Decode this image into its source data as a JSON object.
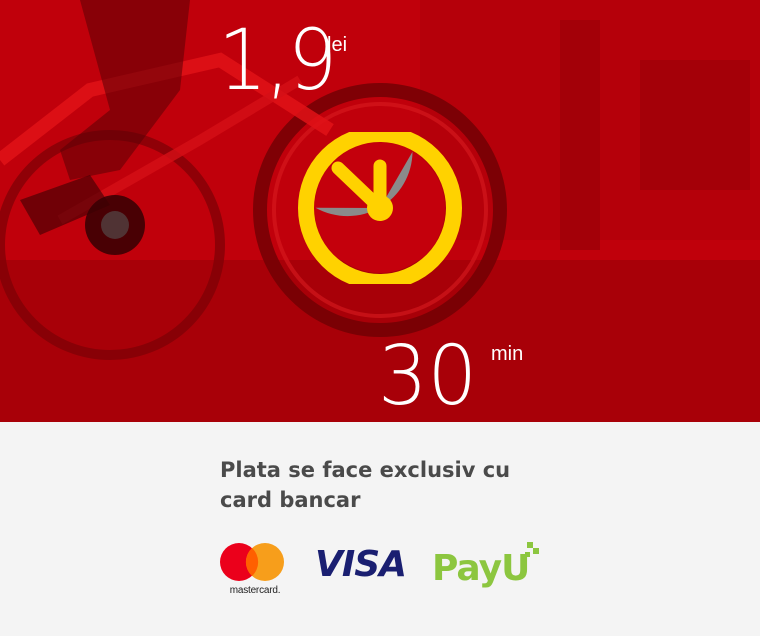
{
  "pricing": {
    "price_value": "1,9",
    "price_unit": "lei",
    "time_value": "30",
    "time_unit": "min"
  },
  "info": {
    "payment_text_line1": "Plata se face exclusiv cu",
    "payment_text_line2": "card bancar"
  },
  "payment_logos": {
    "mastercard_label": "mastercard.",
    "visa_label": "VISA",
    "payu_label": "PayU"
  },
  "colors": {
    "hero_red": "#c4000c",
    "clock_yellow": "#ffd200",
    "clock_gray": "#8a8a8a",
    "text_dark": "#4a4a4a",
    "visa_blue": "#1a1f71",
    "payu_green": "#8cc63f"
  },
  "icons": {
    "clock": "clock-icon",
    "mastercard": "mastercard-logo",
    "visa": "visa-logo",
    "payu": "payu-logo"
  }
}
